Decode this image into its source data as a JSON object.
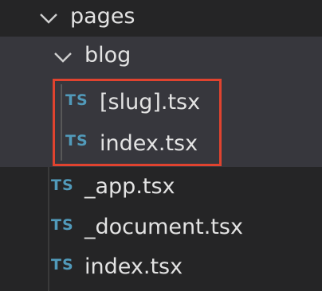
{
  "tree": {
    "folders": [
      {
        "name": "pages",
        "expanded": true
      },
      {
        "name": "blog",
        "expanded": true
      }
    ],
    "blog_files": [
      {
        "name": "[slug].tsx",
        "icon": "typescript-icon",
        "icon_text": "TS"
      },
      {
        "name": "index.tsx",
        "icon": "typescript-icon",
        "icon_text": "TS"
      }
    ],
    "pages_files": [
      {
        "name": "_app.tsx",
        "icon": "typescript-icon",
        "icon_text": "TS"
      },
      {
        "name": "_document.tsx",
        "icon": "typescript-icon",
        "icon_text": "TS"
      },
      {
        "name": "index.tsx",
        "icon": "typescript-icon",
        "icon_text": "TS"
      }
    ]
  },
  "colors": {
    "background": "#252526",
    "selected_row": "#37373d",
    "text": "#e3e3e3",
    "ts_icon": "#519aba",
    "highlight_border": "#e0432f"
  }
}
